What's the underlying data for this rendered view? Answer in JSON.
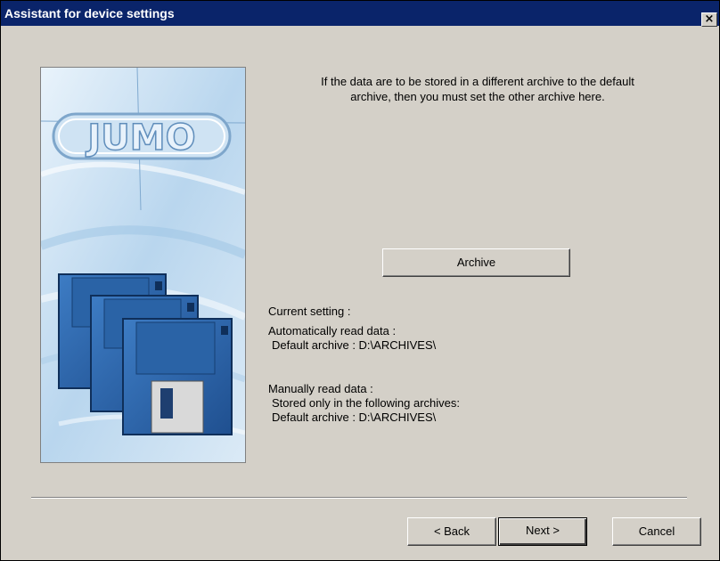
{
  "window": {
    "title": "Assistant for device settings",
    "close_glyph": "×"
  },
  "picture": {
    "logo_text": "JUMO",
    "icons": [
      "jumo-logo",
      "floppy-disk-icon"
    ]
  },
  "content": {
    "intro_line1": "If the data are to be stored in a different archive to the default",
    "intro_line2": "archive, then you must set the other archive here.",
    "archive_button": "Archive",
    "current_setting_label": "Current setting :",
    "auto_label": "Automatically read data :",
    "auto_default": "Default archive : D:\\ARCHIVES\\",
    "manual_label": "Manually read data :",
    "manual_stored": "Stored only in the following archives:",
    "manual_default": "Default archive : D:\\ARCHIVES\\"
  },
  "footer": {
    "back_label": "< Back",
    "next_label": "Next >",
    "cancel_label": "Cancel"
  },
  "colors": {
    "titlebar": "#0a246a",
    "dialog_bg": "#d4d0c8",
    "floppy_blue": "#2f6db5"
  }
}
